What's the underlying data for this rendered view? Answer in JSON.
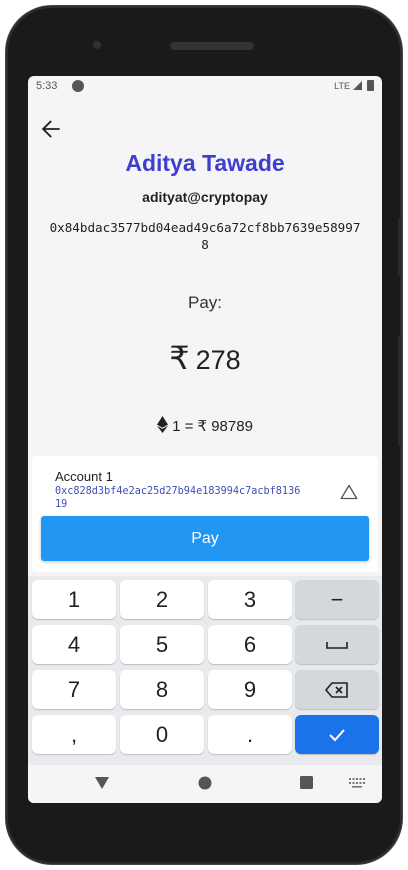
{
  "status": {
    "time": "5:33",
    "network": "LTE"
  },
  "payee": {
    "name": "Aditya Tawade",
    "handle": "adityat@cryptopay",
    "address": "0x84bdac3577bd04ead49c6a72cf8bb7639e589978"
  },
  "payment": {
    "label": "Pay:",
    "currency_symbol": "₹",
    "amount": "278",
    "rate": "1 = ₹ 98789"
  },
  "account": {
    "name": "Account 1",
    "address": "0xc828d3bf4e2ac25d27b94e183994c7acbf813619",
    "pay_label": "Pay"
  },
  "keypad": {
    "keys": [
      "1",
      "2",
      "3",
      "−",
      "4",
      "5",
      "6",
      "␣",
      "7",
      "8",
      "9",
      "⌫",
      ",",
      "0",
      ".",
      "✓"
    ]
  },
  "colors": {
    "accent": "#3f3fcf",
    "button": "#2196f3",
    "enter": "#1a73e8"
  }
}
